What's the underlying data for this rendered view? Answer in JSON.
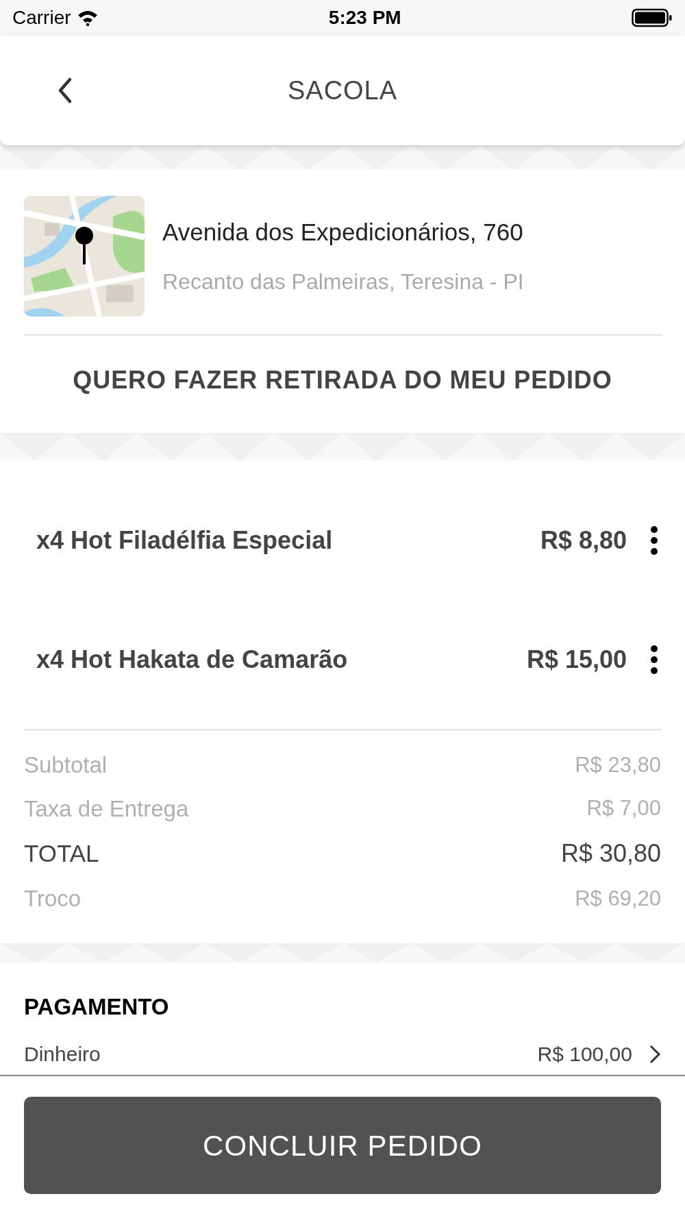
{
  "status_bar": {
    "carrier": "Carrier",
    "time": "5:23 PM"
  },
  "header": {
    "title": "SACOLA"
  },
  "address": {
    "street": "Avenida dos Expedicionários, 760",
    "district": "Recanto das Palmeiras, Teresina - PI"
  },
  "pickup_link": "QUERO FAZER RETIRADA DO MEU PEDIDO",
  "items": [
    {
      "name": "x4 Hot Filadélfia Especial",
      "price": "R$ 8,80"
    },
    {
      "name": "x4 Hot Hakata de Camarão",
      "price": "R$ 15,00"
    }
  ],
  "summary": [
    {
      "kind": "normal",
      "label": "Subtotal",
      "value": "R$ 23,80"
    },
    {
      "kind": "normal",
      "label": "Taxa de Entrega",
      "value": "R$ 7,00"
    },
    {
      "kind": "total",
      "label": "TOTAL",
      "value": "R$ 30,80"
    },
    {
      "kind": "normal",
      "label": "Troco",
      "value": "R$ 69,20"
    }
  ],
  "payment": {
    "title": "PAGAMENTO",
    "method": "Dinheiro",
    "amount": "R$ 100,00"
  },
  "submit_button": "CONCLUIR PEDIDO"
}
